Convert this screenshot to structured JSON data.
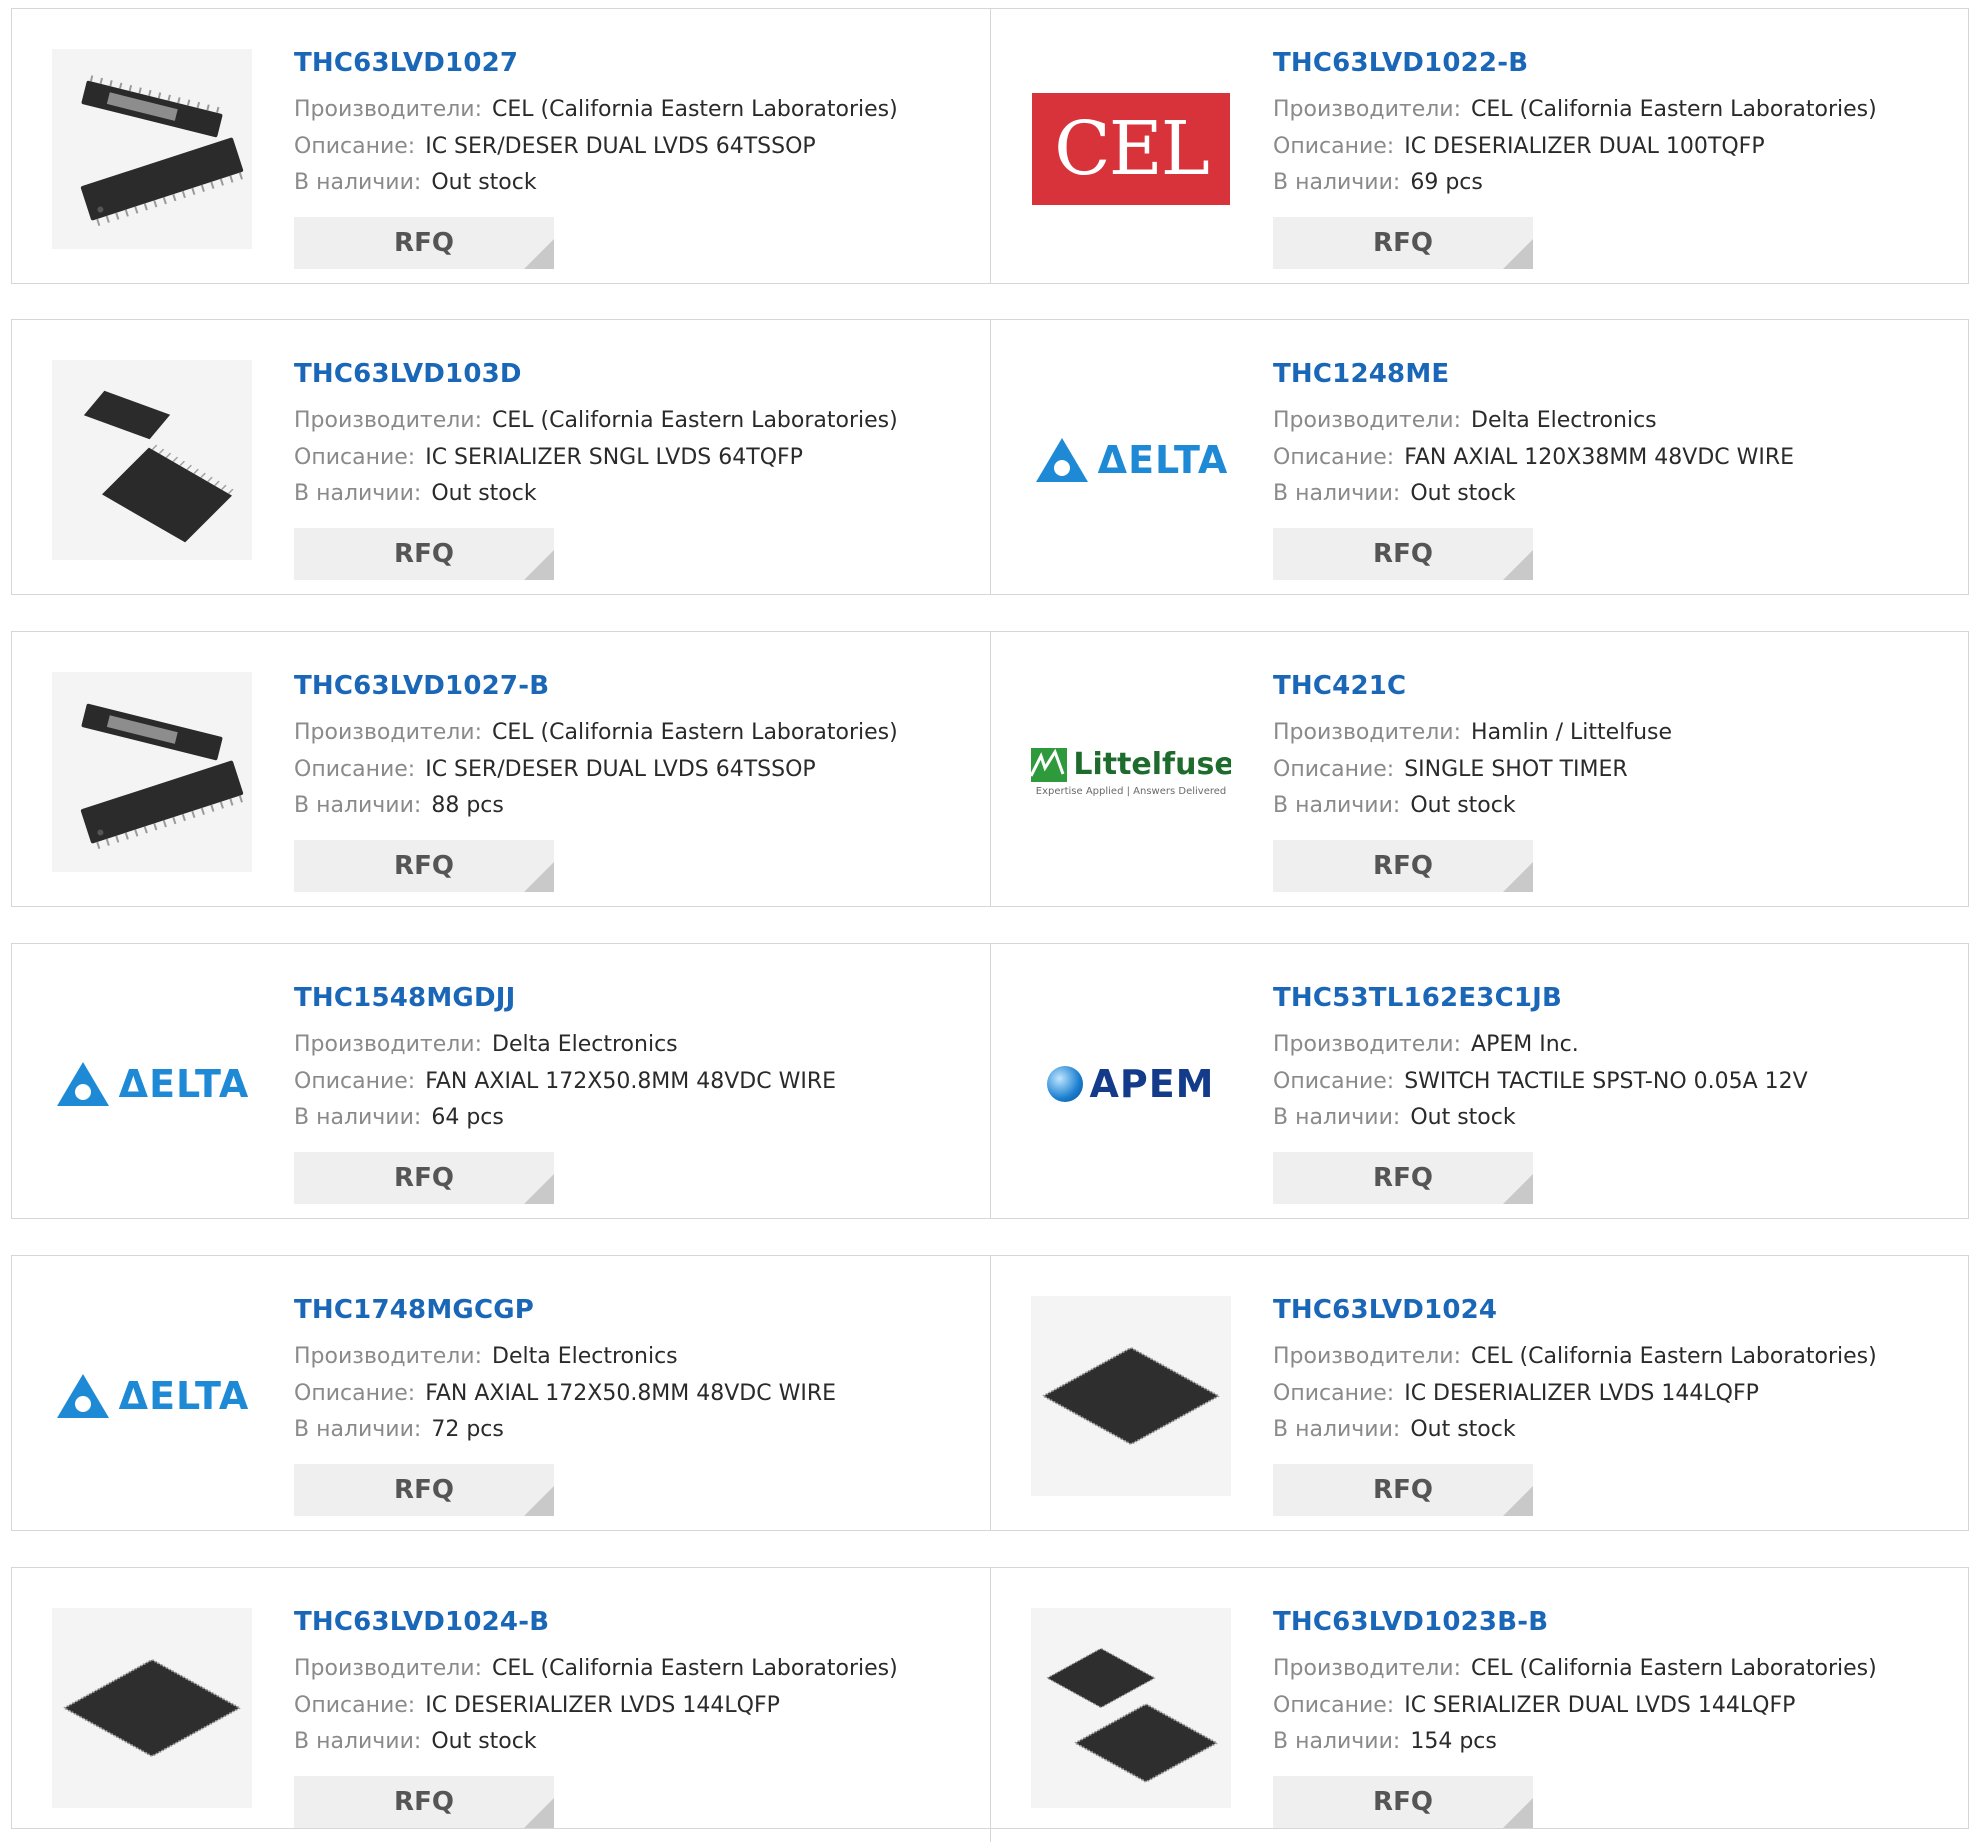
{
  "labels": {
    "manufacturer": "Производители:",
    "description": "Описание:",
    "stock": "В наличии:",
    "rfq": "RFQ"
  },
  "rows": [
    [
      {
        "part": "THC63LVD1027",
        "manufacturer": "CEL (California Eastern Laboratories)",
        "description": "IC SER/DESER DUAL LVDS 64TSSOP",
        "stock": "Out stock",
        "image": "tssop-chip"
      },
      {
        "part": "THC63LVD1022-B",
        "manufacturer": "CEL (California Eastern Laboratories)",
        "description": "IC DESERIALIZER DUAL 100TQFP",
        "stock": "69 pcs",
        "image": "cel-logo",
        "logo_text": "CEL"
      }
    ],
    [
      {
        "part": "THC63LVD103D",
        "manufacturer": "CEL (California Eastern Laboratories)",
        "description": "IC SERIALIZER SNGL LVDS 64TQFP",
        "stock": "Out stock",
        "image": "tqfp-chip"
      },
      {
        "part": "THC1248ME",
        "manufacturer": "Delta Electronics",
        "description": "FAN AXIAL 120X38MM 48VDC WIRE",
        "stock": "Out stock",
        "image": "delta-logo",
        "logo_text": "ΔELTA"
      }
    ],
    [
      {
        "part": "THC63LVD1027-B",
        "manufacturer": "CEL (California Eastern Laboratories)",
        "description": "IC SER/DESER DUAL LVDS 64TSSOP",
        "stock": "88 pcs",
        "image": "tssop-chip"
      },
      {
        "part": "THC421C",
        "manufacturer": "Hamlin / Littelfuse",
        "description": "SINGLE SHOT TIMER",
        "stock": "Out stock",
        "image": "littelfuse-logo",
        "logo_text": "Littelfuse",
        "logo_tagline": "Expertise Applied | Answers Delivered"
      }
    ],
    [
      {
        "part": "THC1548MGDJJ",
        "manufacturer": "Delta Electronics",
        "description": "FAN AXIAL 172X50.8MM 48VDC WIRE",
        "stock": "64 pcs",
        "image": "delta-logo",
        "logo_text": "ΔELTA"
      },
      {
        "part": "THC53TL162E3C1JB",
        "manufacturer": "APEM Inc.",
        "description": "SWITCH TACTILE SPST-NO 0.05A 12V",
        "stock": "Out stock",
        "image": "apem-logo",
        "logo_text": "APEM"
      }
    ],
    [
      {
        "part": "THC1748MGCGP",
        "manufacturer": "Delta Electronics",
        "description": "FAN AXIAL 172X50.8MM 48VDC WIRE",
        "stock": "72 pcs",
        "image": "delta-logo",
        "logo_text": "ΔELTA"
      },
      {
        "part": "THC63LVD1024",
        "manufacturer": "CEL (California Eastern Laboratories)",
        "description": "IC DESERIALIZER LVDS 144LQFP",
        "stock": "Out stock",
        "image": "lqfp-chip"
      }
    ],
    [
      {
        "part": "THC63LVD1024-B",
        "manufacturer": "CEL (California Eastern Laboratories)",
        "description": "IC DESERIALIZER LVDS 144LQFP",
        "stock": "Out stock",
        "image": "lqfp-chip"
      },
      {
        "part": "THC63LVD1023B-B",
        "manufacturer": "CEL (California Eastern Laboratories)",
        "description": "IC SERIALIZER DUAL LVDS 144LQFP",
        "stock": "154 pcs",
        "image": "lqfp-pair-chip"
      }
    ]
  ],
  "colors": {
    "part_link": "#1a66b7",
    "label": "#8a8a8a",
    "value": "#2a2a2a",
    "border": "#d6d6d6",
    "rfq_bg": "#efefef",
    "cel_red": "#d8323a",
    "delta_blue": "#1e8ad6",
    "apem_navy": "#133b8a",
    "littelfuse_green": "#2e9a3c"
  }
}
